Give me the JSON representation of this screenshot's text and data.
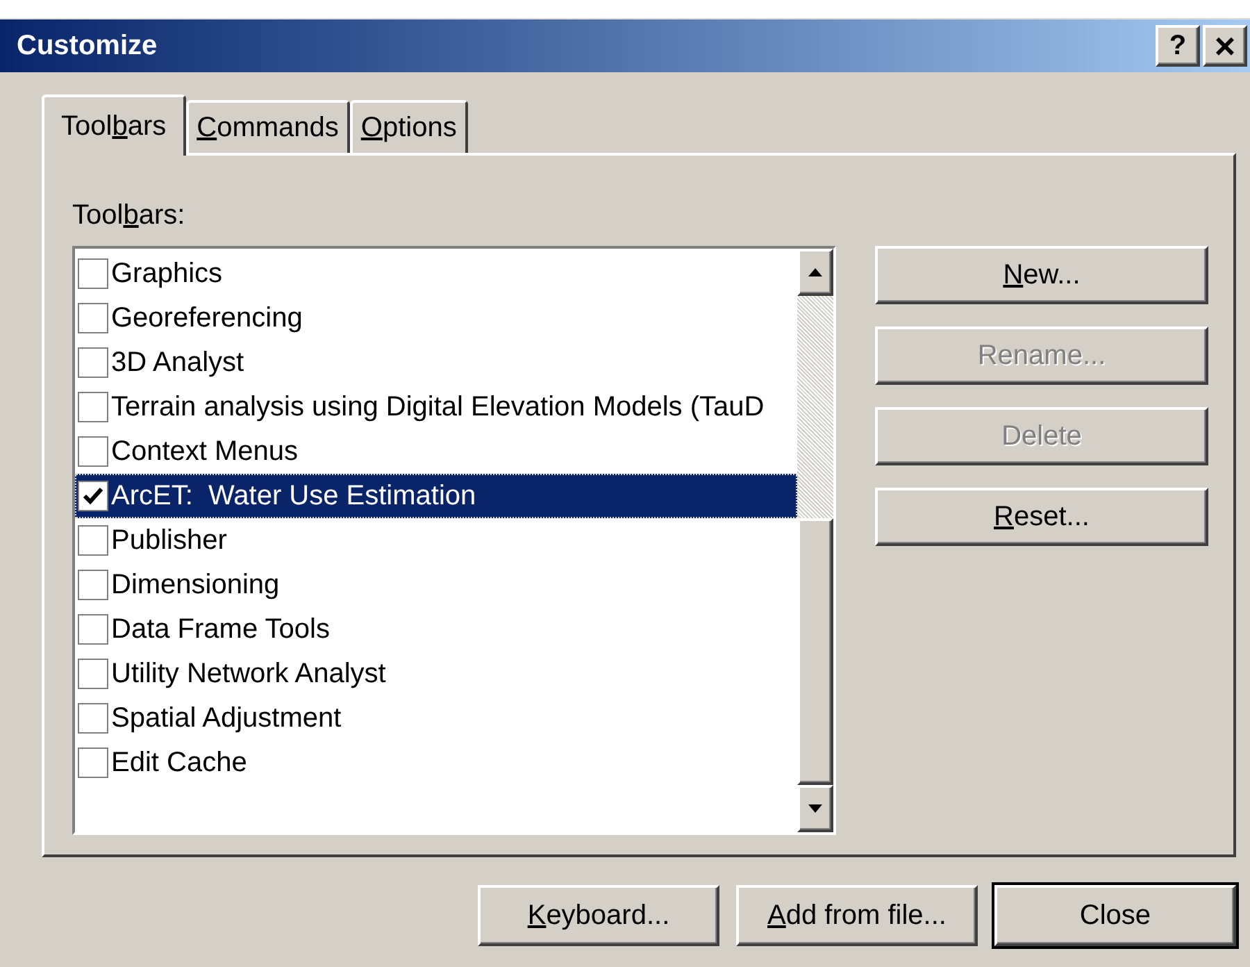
{
  "window": {
    "title": "Customize",
    "help_button": "?",
    "close_button": "×"
  },
  "tabs": [
    {
      "pre": "Tool",
      "key": "b",
      "post": "ars",
      "selected": true
    },
    {
      "key": "C",
      "post": "ommands",
      "selected": false
    },
    {
      "key": "O",
      "post": "ptions",
      "selected": false
    }
  ],
  "toolbars_label": {
    "pre": "Tool",
    "key": "b",
    "post": "ars:"
  },
  "toolbars": [
    {
      "label": "Graphics",
      "checked": false,
      "selected": false
    },
    {
      "label": "Georeferencing",
      "checked": false,
      "selected": false
    },
    {
      "label": "3D Analyst",
      "checked": false,
      "selected": false
    },
    {
      "label": "Terrain analysis using Digital Elevation Models (TauD",
      "checked": false,
      "selected": false
    },
    {
      "label": "Context Menus",
      "checked": false,
      "selected": false
    },
    {
      "label": "ArcET:  Water Use Estimation",
      "checked": true,
      "selected": true
    },
    {
      "label": "Publisher",
      "checked": false,
      "selected": false
    },
    {
      "label": "Dimensioning",
      "checked": false,
      "selected": false
    },
    {
      "label": "Data Frame Tools",
      "checked": false,
      "selected": false
    },
    {
      "label": "Utility Network Analyst",
      "checked": false,
      "selected": false
    },
    {
      "label": "Spatial Adjustment",
      "checked": false,
      "selected": false
    },
    {
      "label": "Edit Cache",
      "checked": false,
      "selected": false
    }
  ],
  "side_buttons": [
    {
      "key": "N",
      "post": "ew...",
      "disabled": false
    },
    {
      "pre": "Rename...",
      "disabled": true
    },
    {
      "pre": "Delete",
      "disabled": true
    },
    {
      "key": "R",
      "post": "eset...",
      "disabled": false
    }
  ],
  "bottom_buttons": [
    {
      "key": "K",
      "post": "eyboard...",
      "default": false
    },
    {
      "key": "A",
      "post": "dd from file...",
      "default": false
    },
    {
      "pre": "Close",
      "default": true
    }
  ]
}
